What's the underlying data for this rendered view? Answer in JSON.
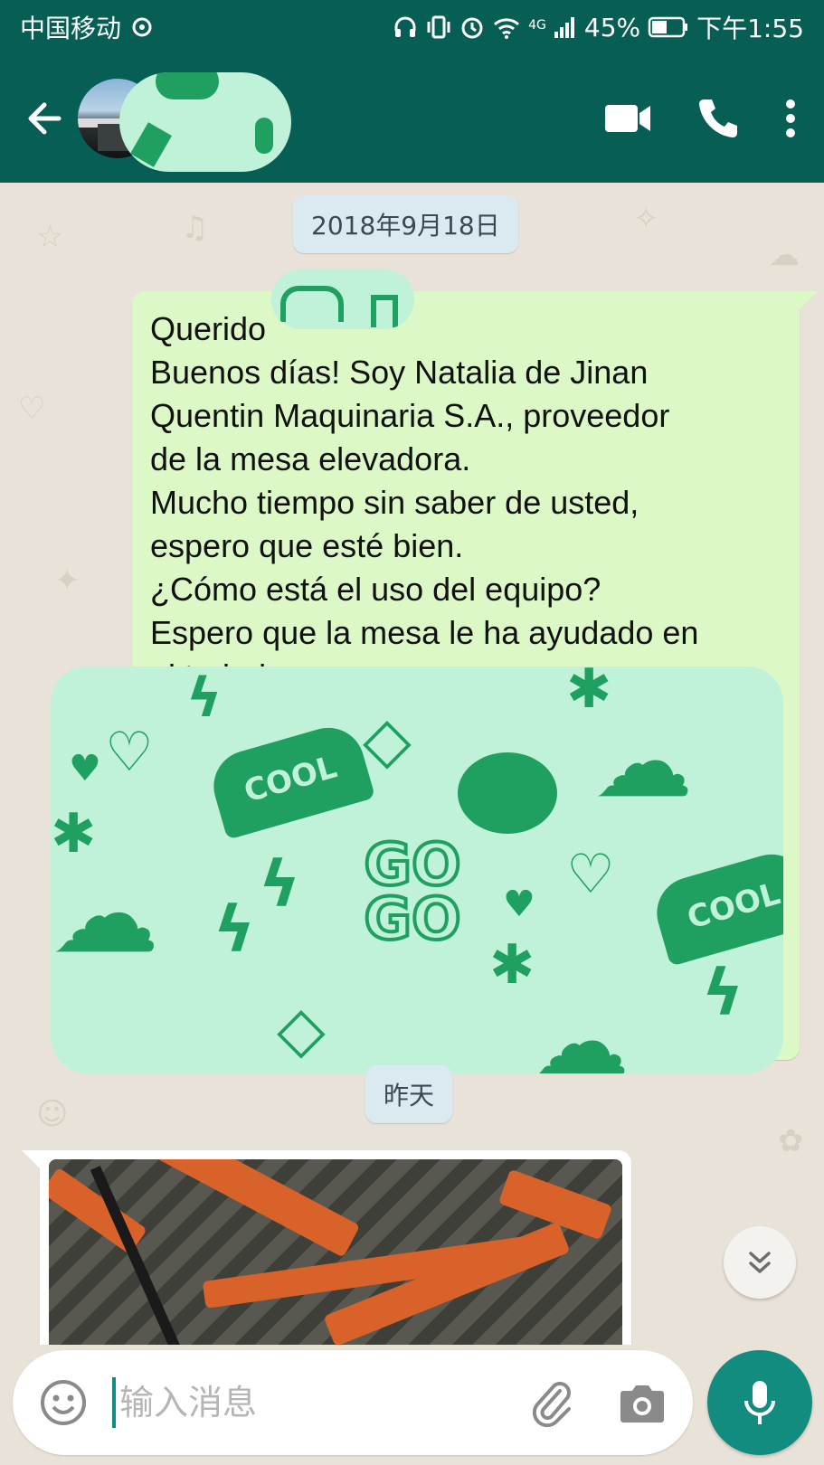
{
  "status_bar": {
    "carrier": "中国移动",
    "network": "4G",
    "battery": "45%",
    "time": "下午1:55"
  },
  "header": {
    "back_icon": "arrow-left-icon",
    "video_icon": "video-camera-icon",
    "call_icon": "phone-icon",
    "menu_icon": "more-vertical-icon"
  },
  "chat": {
    "date_1": "2018年9月18日",
    "message_lines": [
      "Querido",
      "Buenos días! Soy Natalia de Jinan",
      "Quentin Maquinaria S.A., proveedor",
      "de la mesa elevadora.",
      "Mucho tiempo sin saber de usted,",
      "espero que esté bien.",
      "¿Cómo está el uso del equipo?",
      "Espero que la mesa le ha ayudado en",
      "el trabajo."
    ],
    "date_2": "昨天"
  },
  "input": {
    "placeholder": "输入消息"
  },
  "colors": {
    "header": "#075e54",
    "outgoing_bubble": "#dcf8c6",
    "accent": "#128c7e"
  }
}
